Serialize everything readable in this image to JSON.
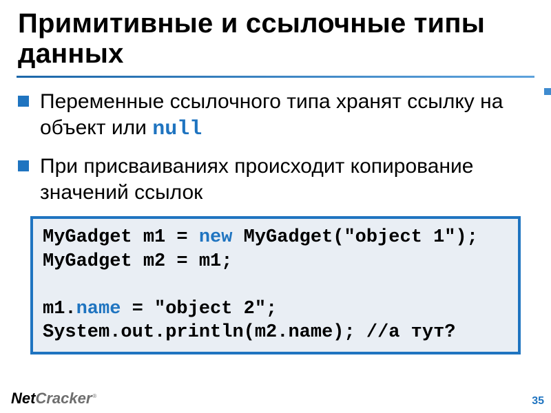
{
  "title": "Примитивные и ссылочные типы данных",
  "bullets": [
    {
      "pre": "Переменные ссылочного типа хранят ссылку на объект или ",
      "kw": "null",
      "post": ""
    },
    {
      "pre": "При присваиваниях происходит копирование значений ссылок",
      "kw": "",
      "post": ""
    }
  ],
  "code": {
    "l1a": "MyGadget m1 = ",
    "l1kw": "new",
    "l1b": " MyGadget(\"object 1\");",
    "l2": "MyGadget m2 = m1;",
    "l3": "",
    "l4a": "m1.",
    "l4kw": "name",
    "l4b": " = \"object 2\";",
    "l5": "System.out.println(m2.name); //а тут?"
  },
  "brand": {
    "part1": "Net",
    "part2": "Cracker",
    "reg": "®"
  },
  "page": "35"
}
